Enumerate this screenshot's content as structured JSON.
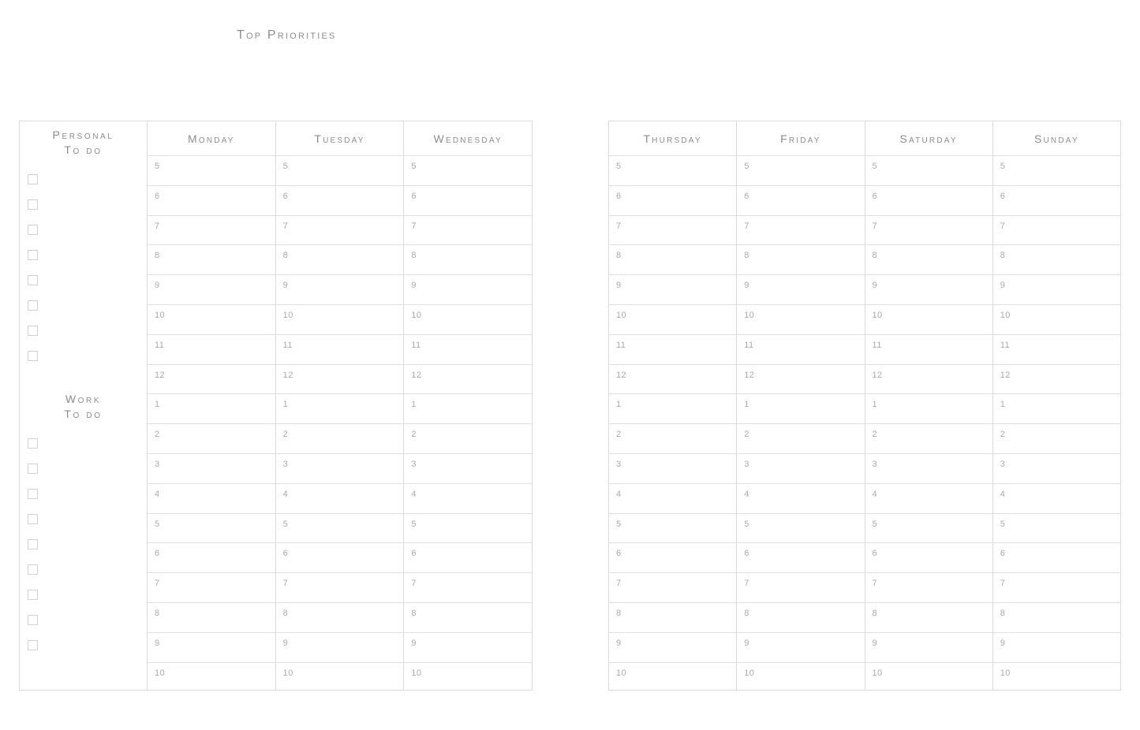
{
  "title": "Top Priorities",
  "todo": {
    "personal_label": "Personal\nTo do",
    "work_label": "Work\nTo do",
    "personal_checkbox_count": 8,
    "work_checkbox_count": 9
  },
  "hours": [
    "5",
    "6",
    "7",
    "8",
    "9",
    "10",
    "11",
    "12",
    "1",
    "2",
    "3",
    "4",
    "5",
    "6",
    "7",
    "8",
    "9",
    "10"
  ],
  "panels": [
    {
      "name": "left",
      "has_todo_column": true,
      "days": [
        "Monday",
        "Tuesday",
        "Wednesday"
      ]
    },
    {
      "name": "right",
      "has_todo_column": false,
      "days": [
        "Thursday",
        "Friday",
        "Saturday",
        "Sunday"
      ]
    }
  ],
  "colors": {
    "border": "#dcdcdc",
    "row_line": "#e0e0e0",
    "heading_text": "#8d8d8d",
    "hour_text": "#aaaaaa",
    "checkbox_border": "#d2d2d2",
    "background": "#ffffff"
  }
}
